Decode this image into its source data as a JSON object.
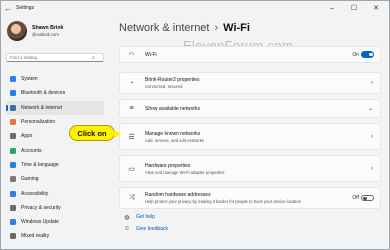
{
  "window": {
    "title": "Settings",
    "back_glyph": "←",
    "min_glyph": "–",
    "max_glyph": "☐",
    "close_glyph": "✕"
  },
  "profile": {
    "name": "Shawn Brink",
    "email": "@outlook.com"
  },
  "search": {
    "placeholder": "Find a setting",
    "icon": "search-icon"
  },
  "sidebar": {
    "items": [
      {
        "label": "System",
        "icon": "system-icon",
        "color": "#2b7de9"
      },
      {
        "label": "Bluetooth & devices",
        "icon": "bluetooth-icon",
        "color": "#2b7de9"
      },
      {
        "label": "Network & internet",
        "icon": "network-icon",
        "color": "#3a6ea5"
      },
      {
        "label": "Personalization",
        "icon": "brush-icon",
        "color": "#e07a3b"
      },
      {
        "label": "Apps",
        "icon": "apps-icon",
        "color": "#6b6b6b"
      },
      {
        "label": "Accounts",
        "icon": "accounts-icon",
        "color": "#2aa36a"
      },
      {
        "label": "Time & language",
        "icon": "globe-icon",
        "color": "#2b7de9"
      },
      {
        "label": "Gaming",
        "icon": "gaming-icon",
        "color": "#777777"
      },
      {
        "label": "Accessibility",
        "icon": "accessibility-icon",
        "color": "#2b7de9"
      },
      {
        "label": "Privacy & security",
        "icon": "shield-icon",
        "color": "#6a6a6a"
      },
      {
        "label": "Windows Update",
        "icon": "update-icon",
        "color": "#2b7de9"
      },
      {
        "label": "Mixed reality",
        "icon": "mixed-reality-icon",
        "color": "#6a6a6a"
      }
    ],
    "active_index": 2
  },
  "header": {
    "section": "Network & internet",
    "separator": "›",
    "page": "Wi-Fi"
  },
  "watermark": "ElevenForum.com",
  "cards": {
    "wifi": {
      "title": "Wi-Fi",
      "state_label": "On",
      "icon_glyph": "◠"
    },
    "router": {
      "title": "Brink-Router2 properties",
      "subtitle": "Connected, secured",
      "icon_glyph": "◔"
    },
    "available": {
      "title": "Show available networks",
      "icon_glyph": "≡"
    },
    "known": {
      "title": "Manage known networks",
      "subtitle": "Add, remove, and edit networks",
      "icon_glyph": "☰"
    },
    "hardware": {
      "title": "Hardware properties",
      "subtitle": "View and manage Wi-Fi adapter properties",
      "icon_glyph": "▭"
    },
    "random": {
      "title": "Random hardware addresses",
      "subtitle": "Help protect your privacy by making it harder for people to track your device location",
      "state_label": "Off",
      "icon_glyph": "⤨"
    },
    "chevron_right": "›",
    "chevron_down": "⌄"
  },
  "links": {
    "help": {
      "label": "Get help",
      "icon_glyph": "◍"
    },
    "feedback": {
      "label": "Give feedback",
      "icon_glyph": "☺"
    }
  },
  "callout": {
    "label": "Click on"
  }
}
